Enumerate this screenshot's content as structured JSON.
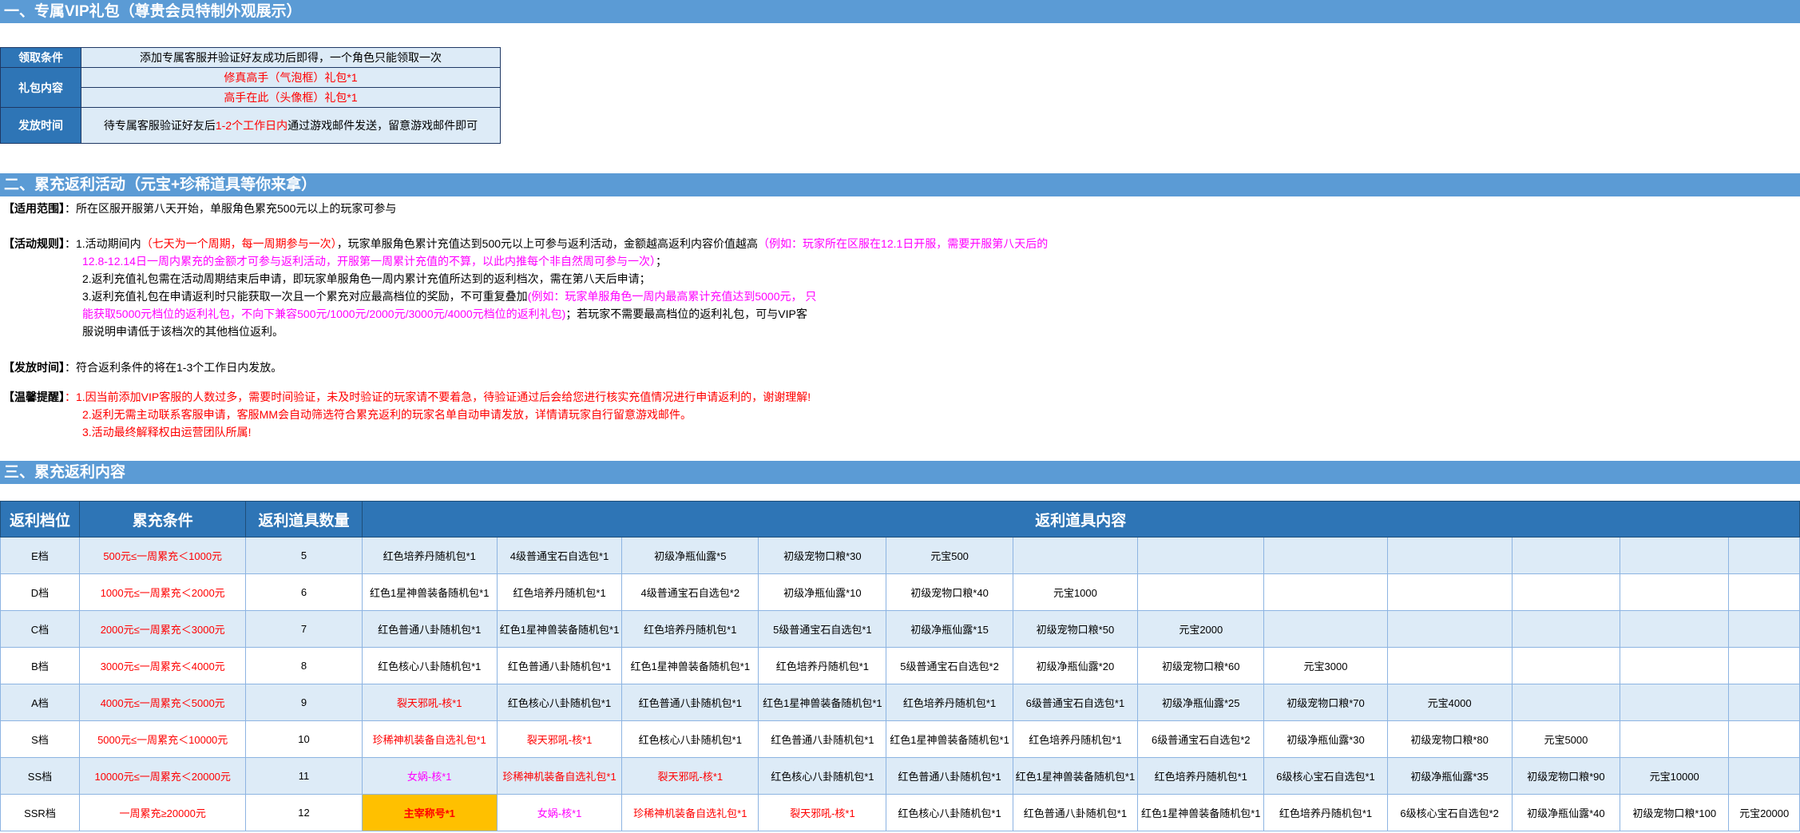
{
  "section1": {
    "title": "一、专属VIP礼包（尊贵会员特制外观展示）",
    "rows": [
      {
        "label": "领取条件",
        "values": [
          "添加专属客服并验证好友成功后即得，一个角色只能领取一次"
        ]
      },
      {
        "label": "礼包内容",
        "values": [
          "修真高手（气泡框）礼包*1",
          "高手在此（头像框）礼包*1"
        ]
      },
      {
        "label": "发放时间",
        "value_pre": "待专属客服验证好友后",
        "value_red": "1-2个工作日内",
        "value_post": "通过游戏邮件发送，留意游戏邮件即可"
      }
    ]
  },
  "section2": {
    "title": "二、累充返利活动（元宝+珍稀道具等你来拿）",
    "scope_label": "【适用范围】",
    "scope_text": "：所在区服开服第八天开始，单服角色累充500元以上的玩家可参与",
    "rules_label": "【活动规则】",
    "rule1_a": "：1.活动期间内",
    "rule1_b": "（七天为一个周期，每一周期参与一次）",
    "rule1_c": "，玩家单服角色累计充值达到500元以上可参与返利活动，金额越高返利内容价值越高",
    "rule1_d": "（例如：玩家所在区服在12.1日开服，需要开服第八天后的",
    "rule1_e": "12.8-12.14日一周内累充的金额才可参与返利活动，开服第一周累计充值的不算，以此内推每个非自然周可参与一次）",
    "rule1_f": "；",
    "rule2": "2.返利充值礼包需在活动周期结束后申请，即玩家单服角色一周内累计充值所达到的返利档次，需在第八天后申请；",
    "rule3_a": "3.返利充值礼包在申请返利时只能获取一次且一个累充对应最高档位的奖励，不可重复叠加",
    "rule3_b": "(例如：玩家单服角色一周内最高累计充值达到5000元，   只",
    "rule3_c": "能获取5000元档位的返利礼包，不向下兼容500元/1000元/2000元/3000元/4000元档位的返利礼包)",
    "rule3_d": "；若玩家不需要最高档位的返利礼包，可与VIP客",
    "rule3_e": "服说明申请低于该档次的其他档位返利。",
    "issue_label": "【发放时间】",
    "issue_text": "：符合返利条件的将在1-3个工作日内发放。",
    "tips_label": "【温馨提醒】",
    "tip1": "：1.因当前添加VIP客服的人数过多，需要时间验证，未及时验证的玩家请不要着急，待验证通过后会给您进行核实充值情况进行申请返利的，谢谢理解!",
    "tip2": "2.返利无需主动联系客服申请，客服MM会自动筛选符合累充返利的玩家名单自动申请发放，详情请玩家自行留意游戏邮件。",
    "tip3": "3.活动最终解释权由运营团队所属!"
  },
  "section3": {
    "title": "三、累充返利内容",
    "headers": [
      "返利档位",
      "累充条件",
      "返利道具数量",
      "返利道具内容"
    ],
    "rows": [
      {
        "tier": "E档",
        "cond": "500元≤一周累充＜1000元",
        "count": "5",
        "items": [
          {
            "t": "红色培养丹随机包*1"
          },
          {
            "t": "4级普通宝石自选包*1"
          },
          {
            "t": "初级净瓶仙露*5"
          },
          {
            "t": "初级宠物口粮*30"
          },
          {
            "t": "元宝500"
          }
        ]
      },
      {
        "tier": "D档",
        "cond": "1000元≤一周累充＜2000元",
        "count": "6",
        "items": [
          {
            "t": "红色1星神兽装备随机包*1"
          },
          {
            "t": "红色培养丹随机包*1"
          },
          {
            "t": "4级普通宝石自选包*2"
          },
          {
            "t": "初级净瓶仙露*10"
          },
          {
            "t": "初级宠物口粮*40"
          },
          {
            "t": "元宝1000"
          }
        ]
      },
      {
        "tier": "C档",
        "cond": "2000元≤一周累充＜3000元",
        "count": "7",
        "items": [
          {
            "t": "红色普通八卦随机包*1"
          },
          {
            "t": "红色1星神兽装备随机包*1"
          },
          {
            "t": "红色培养丹随机包*1"
          },
          {
            "t": "5级普通宝石自选包*1"
          },
          {
            "t": "初级净瓶仙露*15"
          },
          {
            "t": "初级宠物口粮*50"
          },
          {
            "t": "元宝2000"
          }
        ]
      },
      {
        "tier": "B档",
        "cond": "3000元≤一周累充＜4000元",
        "count": "8",
        "items": [
          {
            "t": "红色核心八卦随机包*1"
          },
          {
            "t": "红色普通八卦随机包*1"
          },
          {
            "t": "红色1星神兽装备随机包*1"
          },
          {
            "t": "红色培养丹随机包*1"
          },
          {
            "t": "5级普通宝石自选包*2"
          },
          {
            "t": "初级净瓶仙露*20"
          },
          {
            "t": "初级宠物口粮*60"
          },
          {
            "t": "元宝3000"
          }
        ]
      },
      {
        "tier": "A档",
        "cond": "4000元≤一周累充＜5000元",
        "count": "9",
        "items": [
          {
            "t": "裂天邪吼-核*1",
            "c": "red"
          },
          {
            "t": "红色核心八卦随机包*1"
          },
          {
            "t": "红色普通八卦随机包*1"
          },
          {
            "t": "红色1星神兽装备随机包*1"
          },
          {
            "t": "红色培养丹随机包*1"
          },
          {
            "t": "6级普通宝石自选包*1"
          },
          {
            "t": "初级净瓶仙露*25"
          },
          {
            "t": "初级宠物口粮*70"
          },
          {
            "t": "元宝4000"
          }
        ]
      },
      {
        "tier": "S档",
        "cond": "5000元≤一周累充＜10000元",
        "count": "10",
        "items": [
          {
            "t": "珍稀神机装备自选礼包*1",
            "c": "red"
          },
          {
            "t": "裂天邪吼-核*1",
            "c": "red"
          },
          {
            "t": "红色核心八卦随机包*1"
          },
          {
            "t": "红色普通八卦随机包*1"
          },
          {
            "t": "红色1星神兽装备随机包*1"
          },
          {
            "t": "红色培养丹随机包*1"
          },
          {
            "t": "6级普通宝石自选包*2"
          },
          {
            "t": "初级净瓶仙露*30"
          },
          {
            "t": "初级宠物口粮*80"
          },
          {
            "t": "元宝5000"
          }
        ]
      },
      {
        "tier": "SS档",
        "cond": "10000元≤一周累充＜20000元",
        "count": "11",
        "items": [
          {
            "t": "女娲-核*1",
            "c": "pink"
          },
          {
            "t": "珍稀神机装备自选礼包*1",
            "c": "red"
          },
          {
            "t": "裂天邪吼-核*1",
            "c": "red"
          },
          {
            "t": "红色核心八卦随机包*1"
          },
          {
            "t": "红色普通八卦随机包*1"
          },
          {
            "t": "红色1星神兽装备随机包*1"
          },
          {
            "t": "红色培养丹随机包*1"
          },
          {
            "t": "6级核心宝石自选包*1"
          },
          {
            "t": "初级净瓶仙露*35"
          },
          {
            "t": "初级宠物口粮*90"
          },
          {
            "t": "元宝10000"
          }
        ]
      },
      {
        "tier": "SSR档",
        "cond": "一周累充≥20000元",
        "count": "12",
        "items": [
          {
            "t": "主宰称号*1",
            "c": "gold"
          },
          {
            "t": "女娲-核*1",
            "c": "pink"
          },
          {
            "t": "珍稀神机装备自选礼包*1",
            "c": "red"
          },
          {
            "t": "裂天邪吼-核*1",
            "c": "red"
          },
          {
            "t": "红色核心八卦随机包*1"
          },
          {
            "t": "红色普通八卦随机包*1"
          },
          {
            "t": "红色1星神兽装备随机包*1"
          },
          {
            "t": "红色培养丹随机包*1"
          },
          {
            "t": "6级核心宝石自选包*2"
          },
          {
            "t": "初级净瓶仙露*40"
          },
          {
            "t": "初级宠物口粮*100"
          },
          {
            "t": "元宝20000"
          }
        ]
      }
    ]
  },
  "colors": {
    "band": "#5b9bd5",
    "header": "#2e75b6",
    "light": "#ddebf7",
    "red": "#ff0000",
    "pink": "#ff00ff",
    "gold": "#ffc000"
  }
}
